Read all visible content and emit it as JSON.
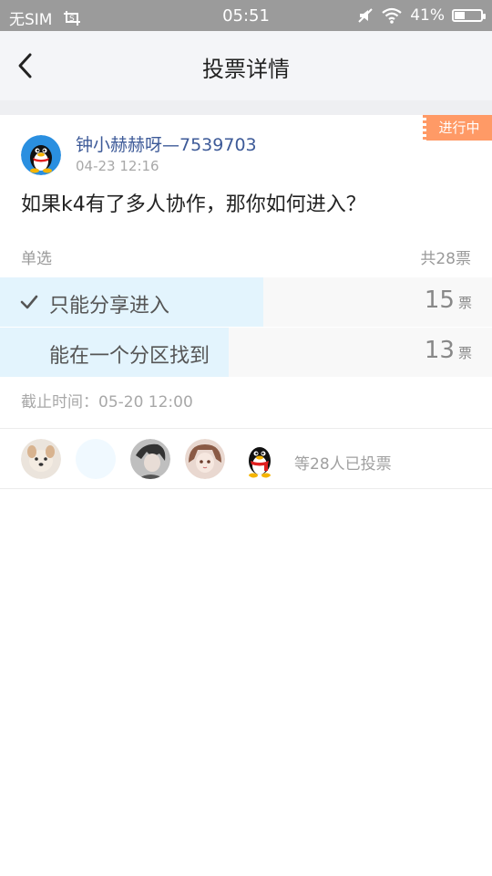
{
  "status_bar": {
    "carrier": "无SIM",
    "time": "05:51",
    "battery": "41%",
    "battery_level": 0.41
  },
  "nav": {
    "title": "投票详情",
    "back_icon": "chevron-left-icon"
  },
  "poll": {
    "status": "进行中",
    "poster_name": "钟小赫赫呀—7539703",
    "post_time": "04-23 12:16",
    "question": "如果k4有了多人协作，那你如何进入？",
    "vote_type": "单选",
    "total": "共28票",
    "options": [
      {
        "label": "只能分享进入",
        "count": "15",
        "unit": "票",
        "selected": true,
        "fraction": 0.536
      },
      {
        "label": "能在一个分区找到",
        "count": "13",
        "unit": "票",
        "selected": false,
        "fraction": 0.464
      }
    ],
    "deadline": "截止时间：05-20 12:00",
    "voters_text": "等28人已投票"
  },
  "colors": {
    "accent_blue": "#3d5a98",
    "status_tag": "#ff9a66",
    "bar_fill": "#e3f4fd"
  }
}
